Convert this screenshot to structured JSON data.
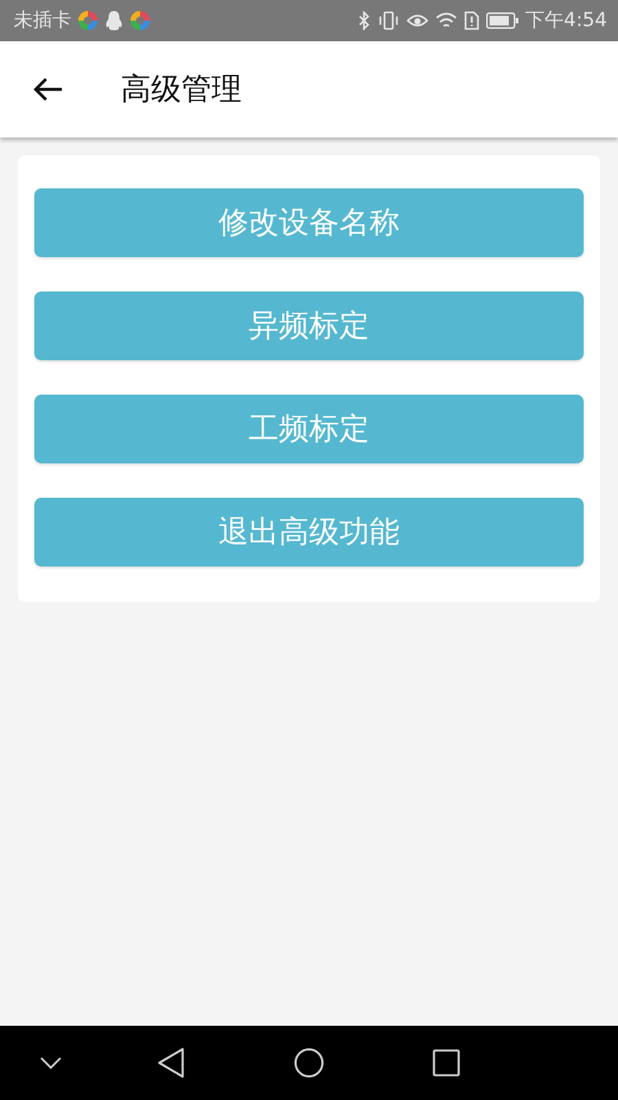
{
  "status_bar": {
    "carrier": "未插卡",
    "time": "下午4:54"
  },
  "app_bar": {
    "title": "高级管理"
  },
  "buttons": [
    "修改设备名称",
    "异频标定",
    "工频标定",
    "退出高级功能"
  ]
}
